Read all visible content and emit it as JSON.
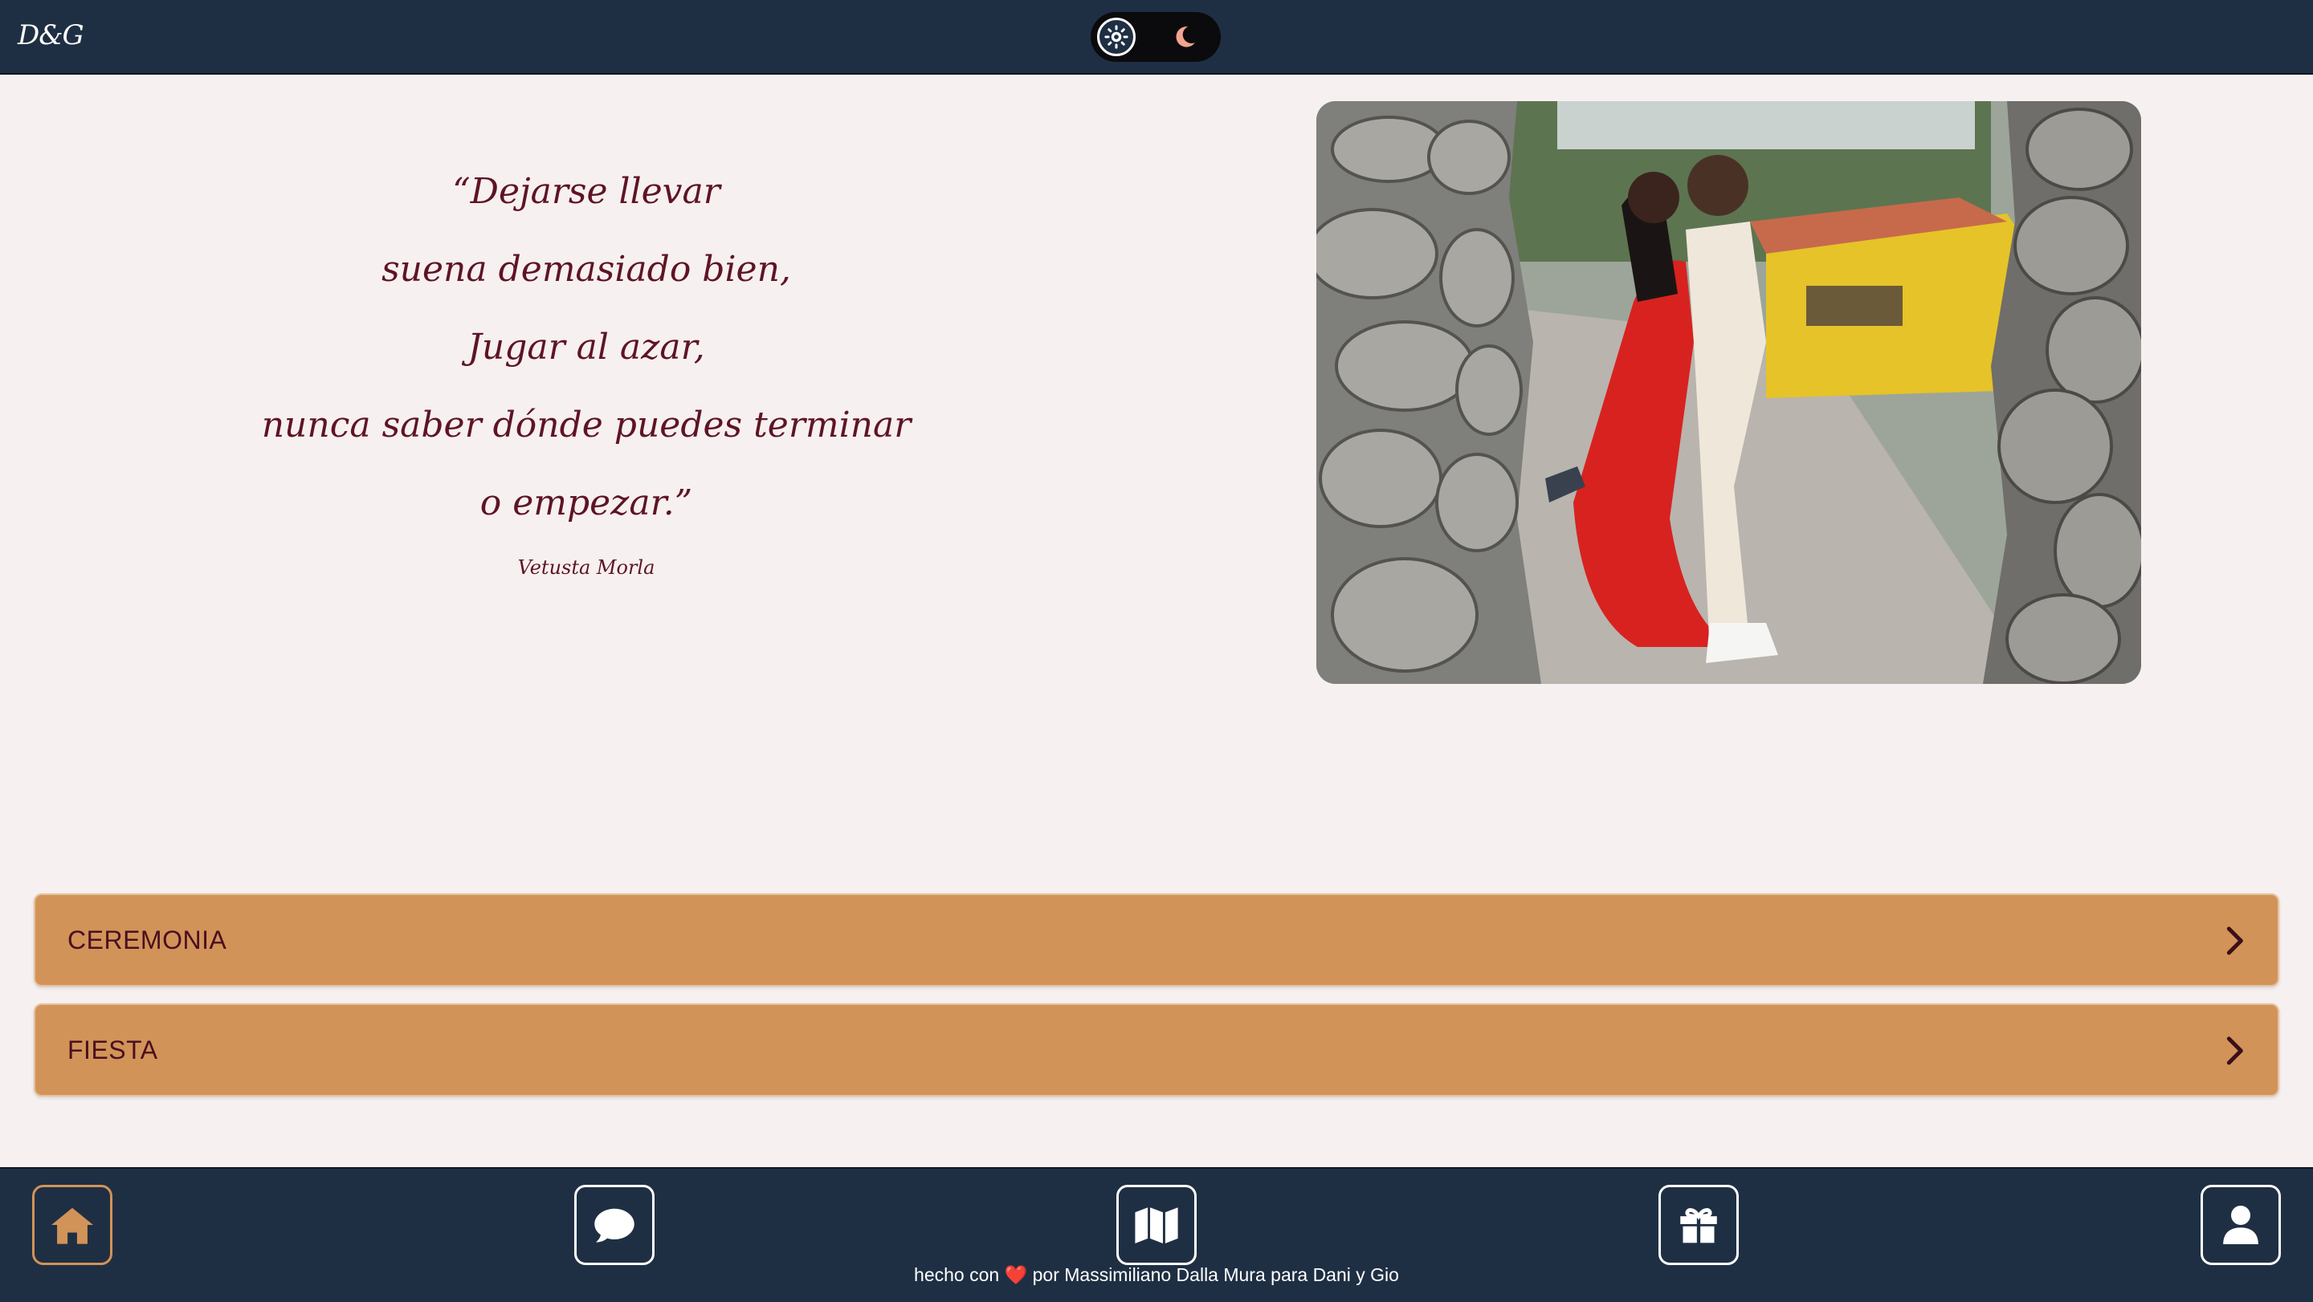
{
  "header": {
    "brand": "D&G",
    "theme_toggle": {
      "light_icon": "sun-icon",
      "dark_icon": "moon-icon",
      "selected": "light"
    }
  },
  "quote": {
    "lines": [
      "“Dejarse llevar",
      "suena demasiado bien,",
      "Jugar al azar,",
      "nunca saber dónde puedes terminar",
      "o empezar.”"
    ],
    "author": "Vetusta Morla"
  },
  "photo": {
    "description_icon": "couple-photo"
  },
  "accordions": [
    {
      "label": "CEREMONIA",
      "icon": "chevron-right-icon"
    },
    {
      "label": "FIESTA",
      "icon": "chevron-right-icon"
    }
  ],
  "bottom_nav": {
    "items": [
      {
        "name": "home",
        "icon": "home-icon",
        "active": true
      },
      {
        "name": "messages",
        "icon": "chat-bubble-icon",
        "active": false
      },
      {
        "name": "map",
        "icon": "map-icon",
        "active": false
      },
      {
        "name": "gifts",
        "icon": "gift-icon",
        "active": false
      },
      {
        "name": "profile",
        "icon": "user-icon",
        "active": false
      }
    ],
    "footer": {
      "prefix": "hecho con",
      "heart": "❤️",
      "suffix": "por Massimiliano Dalla Mura para Dani y Gio"
    }
  },
  "colors": {
    "navbar": "#1f2f43",
    "accent": "#d29358",
    "text_wine": "#5e1424",
    "background": "#f7f0f0"
  }
}
